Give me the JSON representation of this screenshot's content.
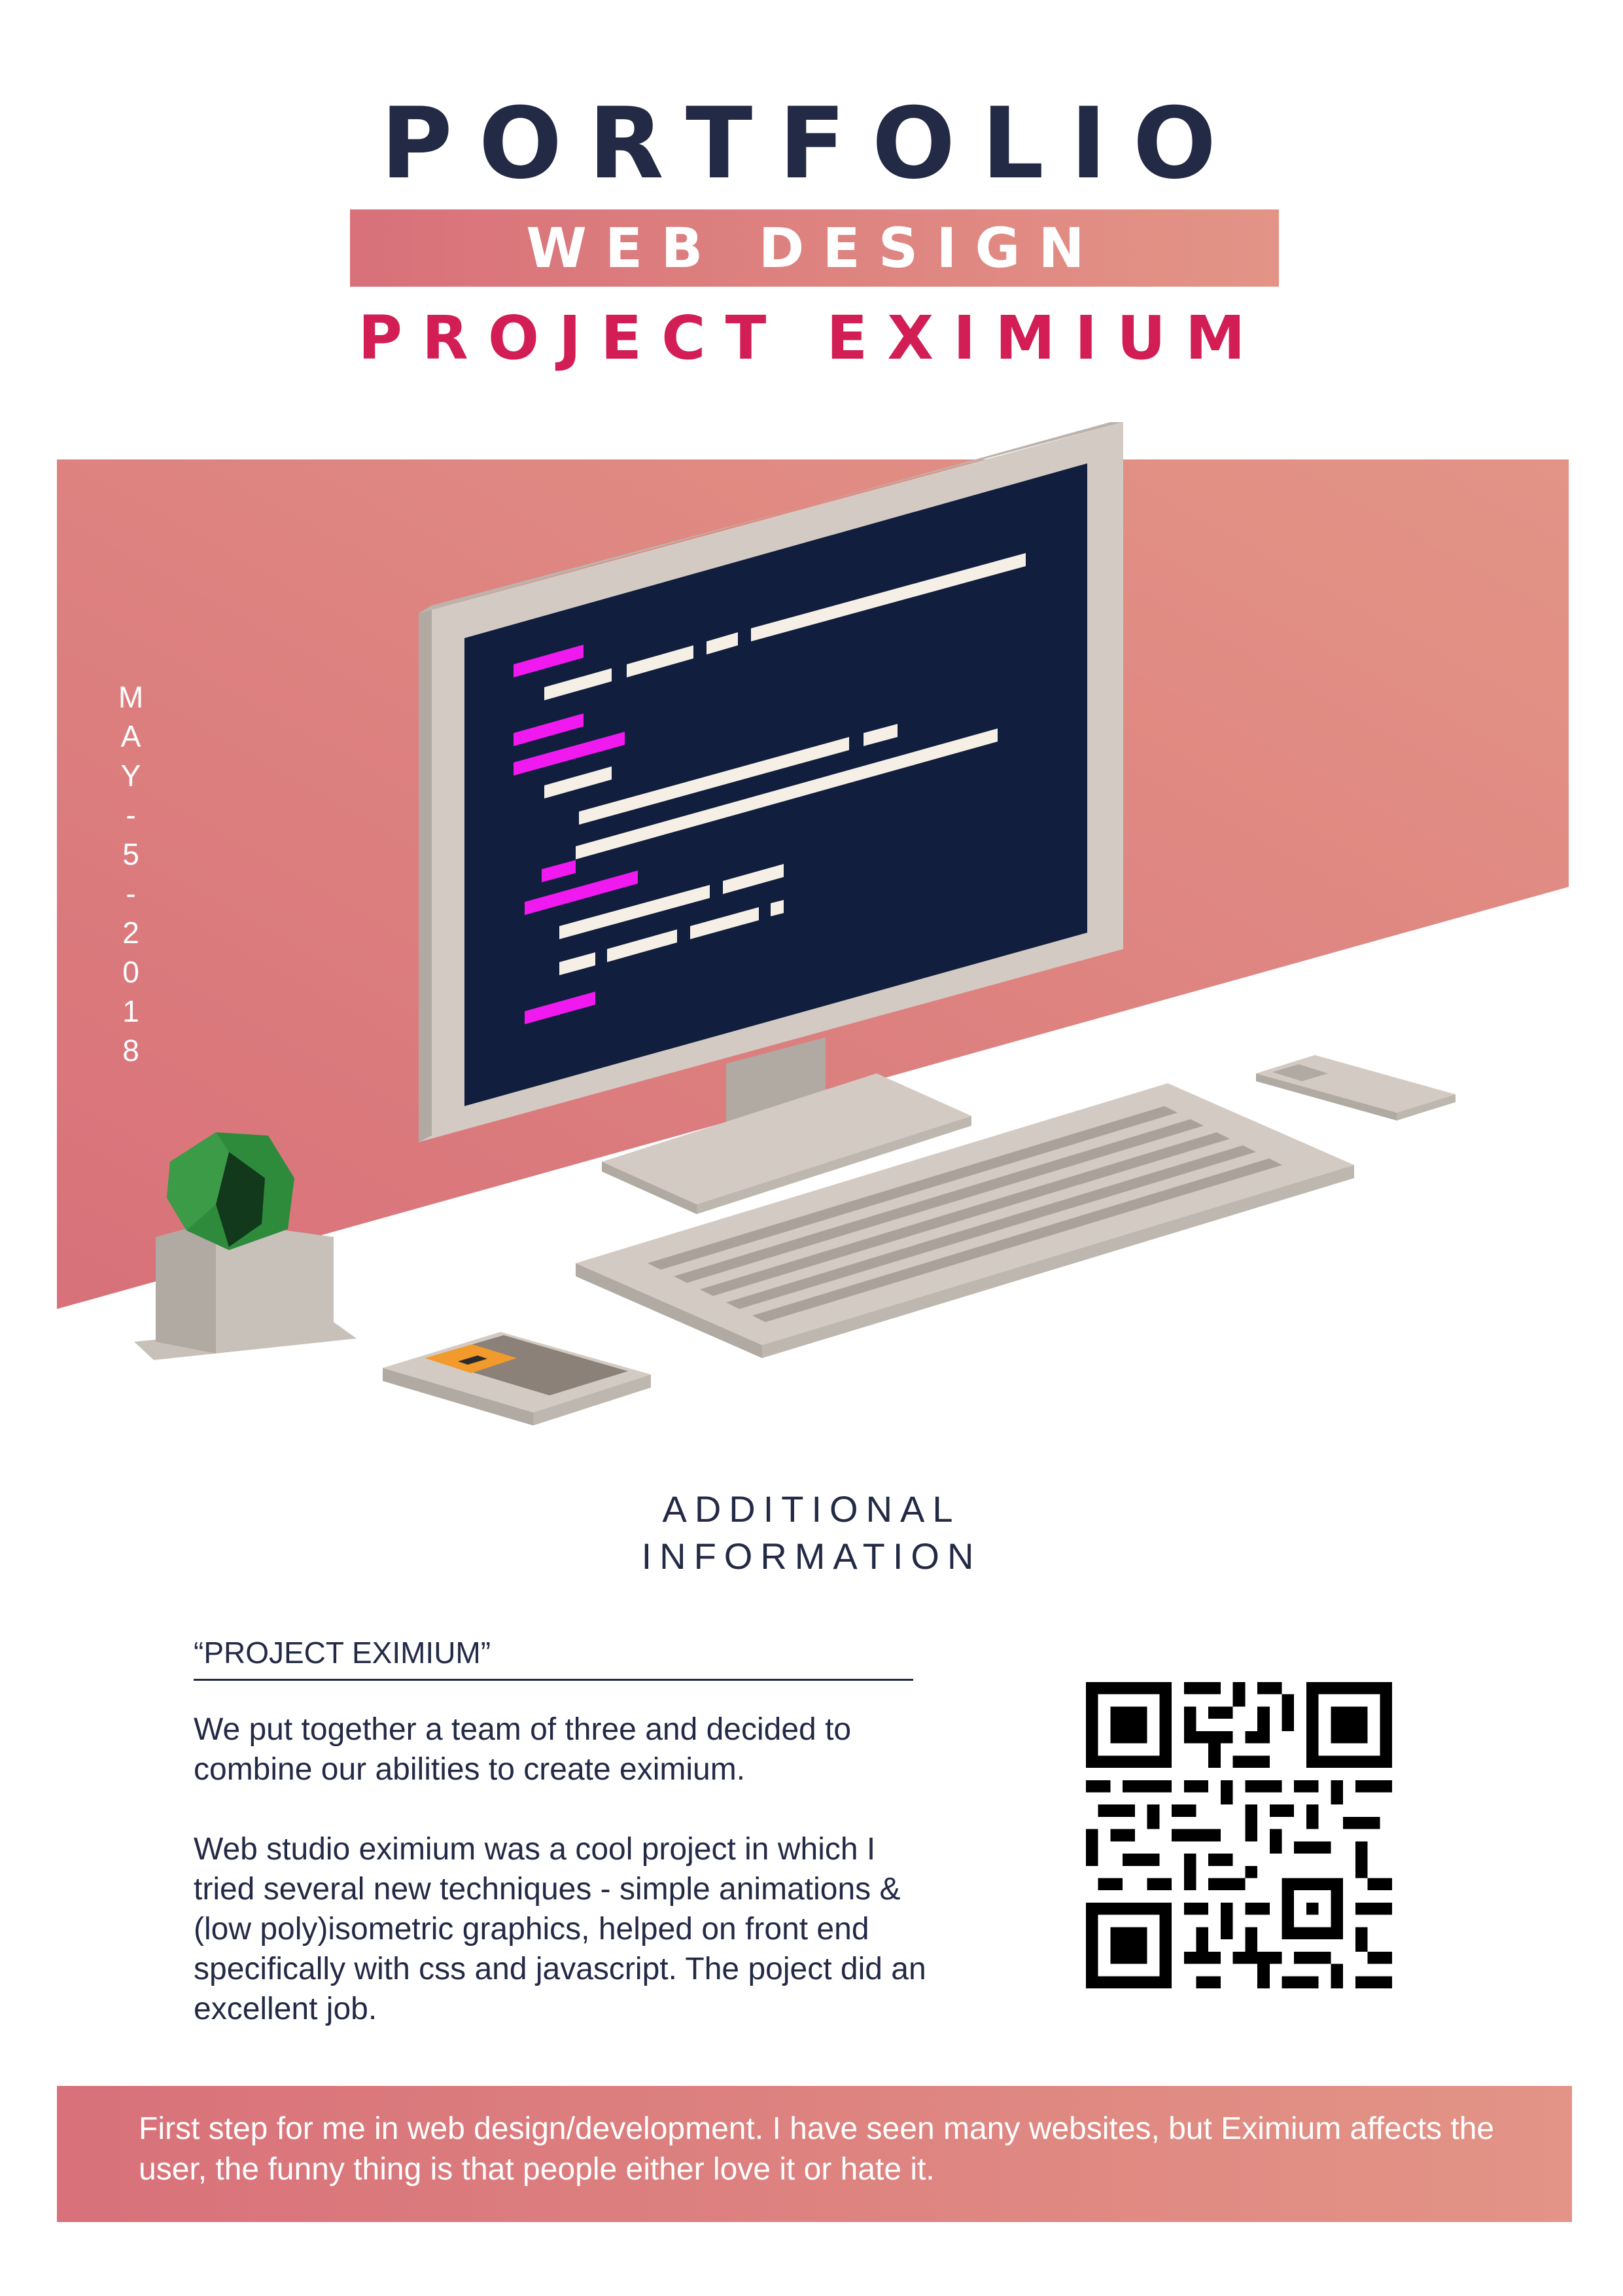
{
  "header": {
    "title": "PORTFOLIO",
    "subtitle": "WEB DESIGN",
    "project_name": "PROJECT EXIMIUM"
  },
  "illustration": {
    "date_vertical": [
      "M",
      "A",
      "Y",
      "-",
      "5",
      "-",
      "2",
      "0",
      "1",
      "8"
    ],
    "icons": [
      "computer-monitor-icon",
      "keyboard-icon",
      "mouse-icon",
      "plant-pot-icon",
      "tablet-icon"
    ]
  },
  "additional": {
    "heading_line1": "ADDITIONAL",
    "heading_line2": "INFORMATION",
    "quote": "“PROJECT EXIMIUM”",
    "paragraph1": "We put together a team of three and decided to combine our abilities to create eximium.",
    "paragraph2": "Web studio eximium was a cool project in which I tried several new techniques - simple animations & (low poly)isometric graphics, helped on front end specifically with css and javascript. The poject did an excellent job."
  },
  "footer": {
    "text": "First step for me in web design/development. I have seen many websites, but Eximium affects the user, the funny thing is that people either love it or hate it."
  },
  "colors": {
    "navy": "#232a46",
    "accent": "#d21e55",
    "gradient_start": "#d8717a",
    "gradient_end": "#e39486",
    "screen": "#111e3e",
    "code_magenta": "#f019f0",
    "code_light": "#f5efe6"
  }
}
